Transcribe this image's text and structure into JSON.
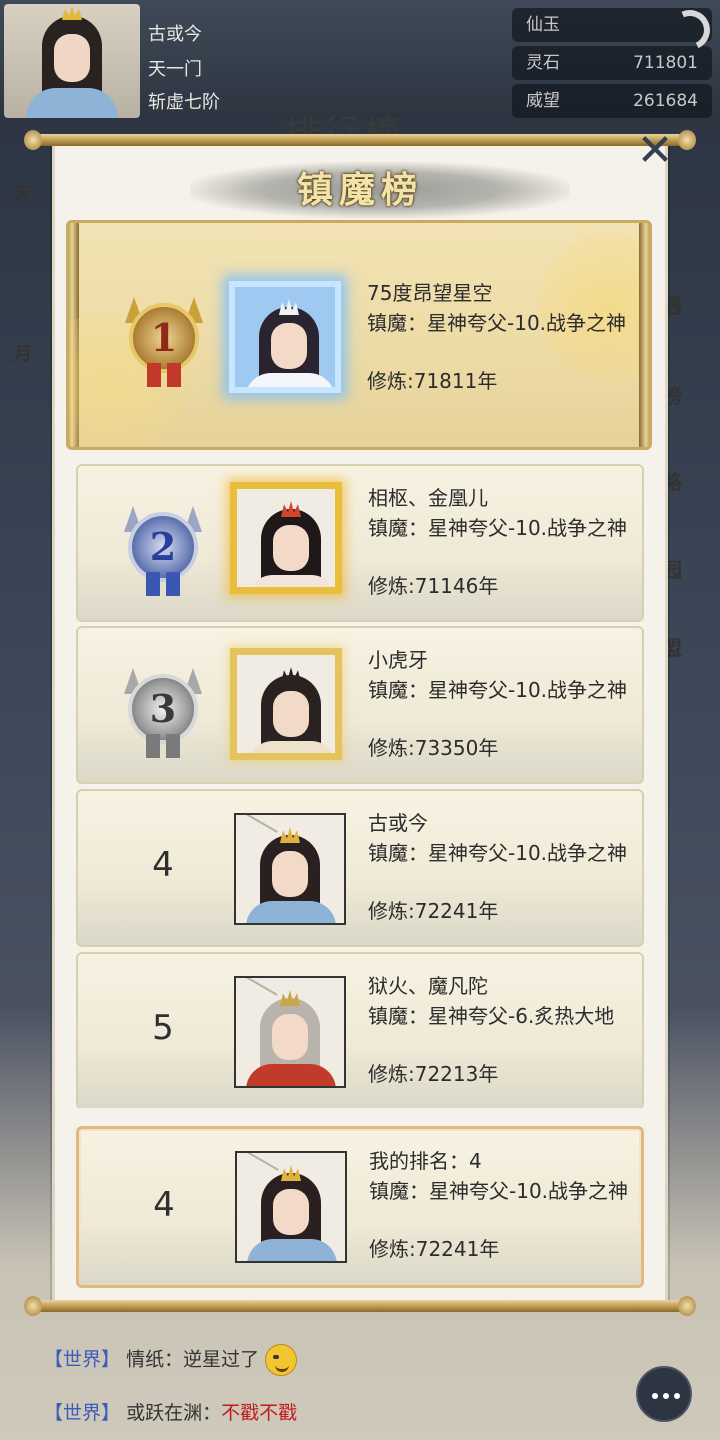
{
  "header": {
    "player_name": "古或今",
    "sect": "天一门",
    "realm": "斩虚七阶",
    "stats": [
      {
        "label": "仙玉",
        "value": ""
      },
      {
        "label": "灵石",
        "value": "711801"
      },
      {
        "label": "威望",
        "value": "261684"
      }
    ],
    "bg_title": "排行榜"
  },
  "side_left": [
    "天",
    "月"
  ],
  "side_right": [
    "遇",
    "榜",
    "略",
    "园",
    "盟"
  ],
  "modal": {
    "title": "镇魔榜",
    "close_icon": "close-icon"
  },
  "rankings": [
    {
      "rank": "1",
      "name": "75度昂望星空",
      "desc": "镇魔：星神夸父-10.战争之神",
      "years": "修炼:71811年"
    },
    {
      "rank": "2",
      "name": "相枢、金凰儿",
      "desc": "镇魔：星神夸父-10.战争之神",
      "years": "修炼:71146年"
    },
    {
      "rank": "3",
      "name": "小虎牙",
      "desc": "镇魔：星神夸父-10.战争之神",
      "years": "修炼:73350年"
    },
    {
      "rank": "4",
      "name": "古或今",
      "desc": "镇魔：星神夸父-10.战争之神",
      "years": "修炼:72241年"
    },
    {
      "rank": "5",
      "name": "狱火、魔凡陀",
      "desc": "镇魔：星神夸父-6.炙热大地",
      "years": "修炼:72213年"
    }
  ],
  "my_rank": {
    "rank": "4",
    "label": "我的排名：4",
    "desc": "镇魔：星神夸父-10.战争之神",
    "years": "修炼:72241年"
  },
  "chat": [
    {
      "channel": "【世界】",
      "sender": "情纸",
      "message": "逆星过了",
      "emoji": "grin-emoji-icon"
    },
    {
      "channel": "【世界】",
      "sender": "或跃在渊",
      "message": "不戳不戳"
    }
  ],
  "colors": {
    "gold": "#e9be3c",
    "rank1": "#8b2a1a",
    "rank2": "#2a3f9a",
    "rank3": "#3a3a3a",
    "chat_channel": "#3b5db8",
    "chat_red": "#c21b1b"
  }
}
